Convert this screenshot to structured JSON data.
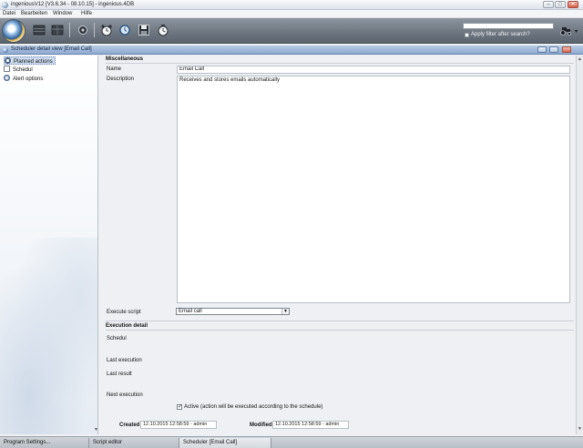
{
  "window": {
    "title": "ingeniousV12 [V3.6.34 - 08.10.15] - ingenious.4DB",
    "minimize": "–",
    "maximize": "□",
    "close": "✕"
  },
  "menu": [
    "Datei",
    "Bearbeiten",
    "Window",
    "Hilfe"
  ],
  "toolbar": {
    "search_value": "",
    "filter_label": "Apply filter after search?",
    "filter_checked": false
  },
  "subwindow": {
    "title": "Scheduler detail view [Email Call]"
  },
  "tree": {
    "items": [
      {
        "label": "Planned actions",
        "icon": "clock-icon",
        "selected": true
      },
      {
        "label": "Schedul",
        "icon": "calendar-icon",
        "selected": false
      },
      {
        "label": "Alert options",
        "icon": "alert-icon",
        "selected": false
      }
    ]
  },
  "form": {
    "misc_section": "Miscellaneous",
    "name_label": "Name",
    "name_value": "Email Call",
    "description_label": "Description",
    "description_value": "Receives and stores emails automatically",
    "execute_script_label": "Execute script",
    "execute_script_value": "Email call",
    "execution_section": "Execution detail",
    "schedul_label": "Schedul",
    "last_execution_label": "Last execution",
    "last_result_label": "Last result",
    "next_execution_label": "Next execution",
    "active_label": "Active (action will be executed according to the schedule)",
    "active_checked": true,
    "created_label": "Created",
    "created_value": "12.10.2015  12:58:59 - admin",
    "modified_label": "Modified",
    "modified_value": "12.10.2015  12:58:59 - admin"
  },
  "taskbar": {
    "tabs": [
      {
        "label": "Program Settings...",
        "active": false
      },
      {
        "label": "Script editor",
        "active": false
      },
      {
        "label": "Scheduler [Email Call]",
        "active": true
      }
    ]
  }
}
